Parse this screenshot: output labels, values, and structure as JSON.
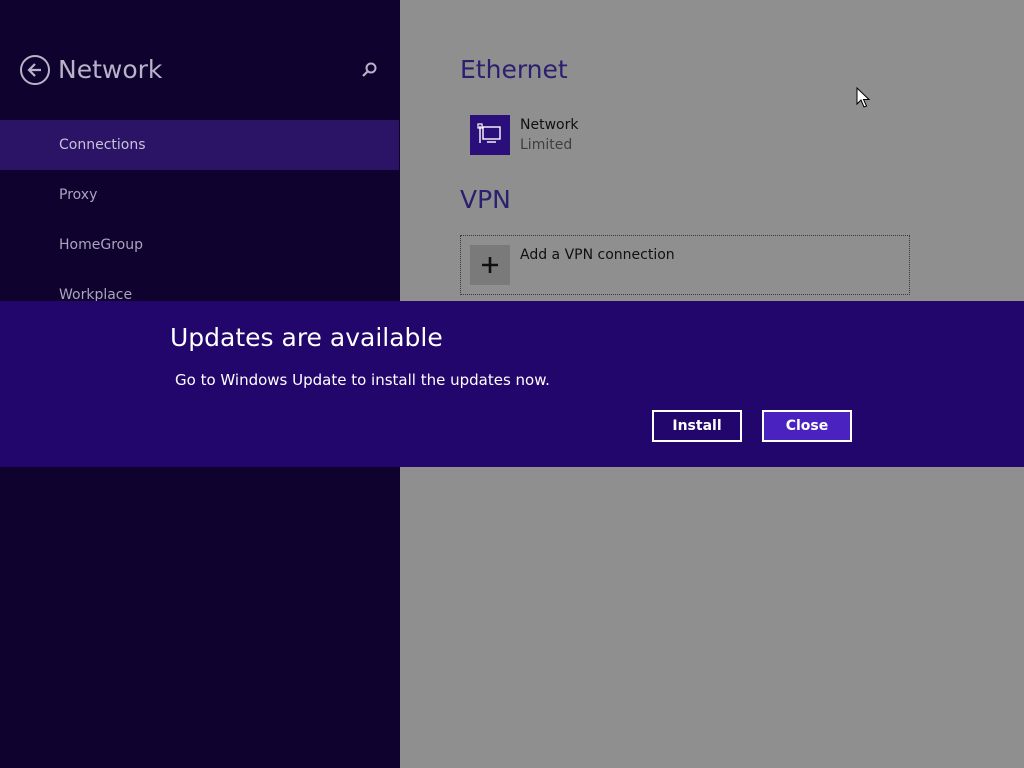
{
  "sidebar": {
    "title": "Network",
    "items": [
      {
        "label": "Connections",
        "selected": true
      },
      {
        "label": "Proxy",
        "selected": false
      },
      {
        "label": "HomeGroup",
        "selected": false
      },
      {
        "label": "Workplace",
        "selected": false
      }
    ]
  },
  "ethernet": {
    "title": "Ethernet",
    "network_name": "Network",
    "network_status": "Limited",
    "icon": "ethernet-network-icon"
  },
  "vpn": {
    "title": "VPN",
    "add_label": "Add a VPN connection",
    "icon": "plus-icon"
  },
  "banner": {
    "title": "Updates are available",
    "message": "Go to Windows Update to install the updates now.",
    "install_label": "Install",
    "close_label": "Close"
  },
  "colors": {
    "sidebar_bg": "#10022e",
    "selected_item_bg": "#2b1366",
    "banner_bg": "#22066b",
    "close_button_bg": "#4a22c0",
    "accent_tile": "#2a0e79"
  }
}
